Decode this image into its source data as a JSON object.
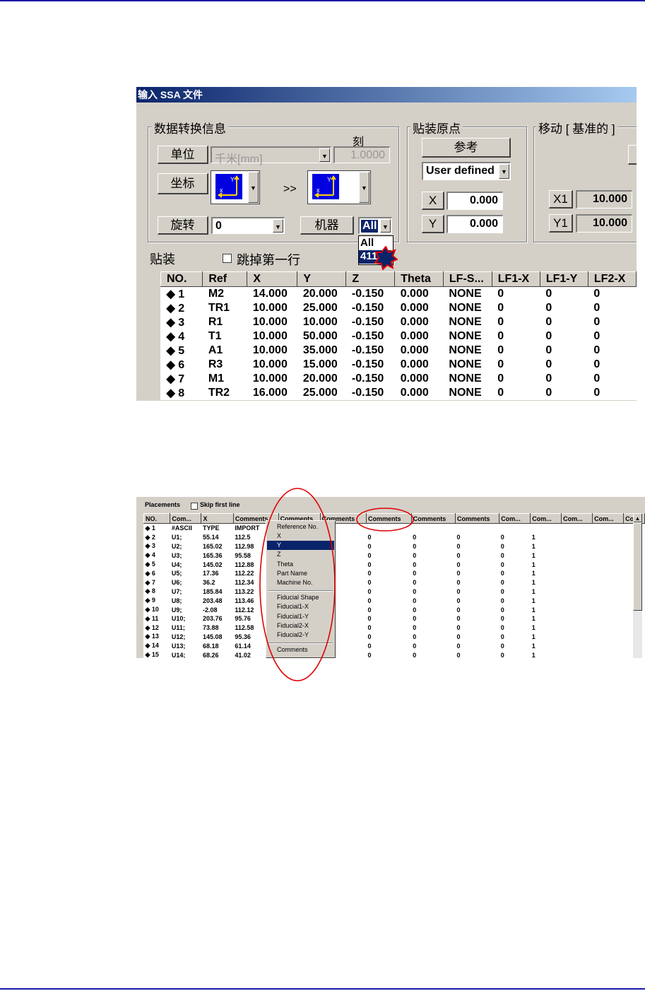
{
  "dialog": {
    "title": "输入 SSA 文件",
    "conversion_group": {
      "label": "数据转换信息",
      "scale_label": "刻",
      "unit_button": "单位",
      "unit_value": "千米[mm]",
      "scale_value": "1.0000",
      "coord_button": "坐标",
      "arrow_text": ">>",
      "rotate_button": "旋转",
      "rotate_value": "0",
      "machine_button": "机器",
      "machine_value": "All",
      "machine_options": [
        "All",
        "411"
      ]
    },
    "origin_group": {
      "label": "贴装原点",
      "reference_button": "参考",
      "reference_value": "User defined",
      "x_label": "X",
      "x_value": "0.000",
      "y_label": "Y",
      "y_value": "0.000"
    },
    "move_group": {
      "label": "移动 [ 基准的 ]",
      "x1_label": "X1",
      "x1_value": "10.000",
      "y1_label": "Y1",
      "y1_value": "10.000"
    },
    "placement_label": "贴装",
    "skip_first_line": "跳掉第一行",
    "table": {
      "headers": [
        "NO.",
        "Ref",
        "X",
        "Y",
        "Z",
        "Theta",
        "LF-S...",
        "LF1-X",
        "LF1-Y",
        "LF2-X"
      ],
      "rows": [
        [
          "◆ 1",
          "M2",
          "14.000",
          "20.000",
          "-0.150",
          "0.000",
          "NONE",
          "0",
          "0",
          "0"
        ],
        [
          "◆ 2",
          "TR1",
          "10.000",
          "25.000",
          "-0.150",
          "0.000",
          "NONE",
          "0",
          "0",
          "0"
        ],
        [
          "◆ 3",
          "R1",
          "10.000",
          "10.000",
          "-0.150",
          "0.000",
          "NONE",
          "0",
          "0",
          "0"
        ],
        [
          "◆ 4",
          "T1",
          "10.000",
          "50.000",
          "-0.150",
          "0.000",
          "NONE",
          "0",
          "0",
          "0"
        ],
        [
          "◆ 5",
          "A1",
          "10.000",
          "35.000",
          "-0.150",
          "0.000",
          "NONE",
          "0",
          "0",
          "0"
        ],
        [
          "◆ 6",
          "R3",
          "10.000",
          "15.000",
          "-0.150",
          "0.000",
          "NONE",
          "0",
          "0",
          "0"
        ],
        [
          "◆ 7",
          "M1",
          "10.000",
          "20.000",
          "-0.150",
          "0.000",
          "NONE",
          "0",
          "0",
          "0"
        ],
        [
          "◆ 8",
          "TR2",
          "16.000",
          "25.000",
          "-0.150",
          "0.000",
          "NONE",
          "0",
          "0",
          "0"
        ]
      ]
    }
  },
  "placements": {
    "label": "Placements",
    "skip_first_line": "Skip first line",
    "headers": [
      "NO.",
      "Com...",
      "X",
      "Comments",
      "Comments",
      "Comments",
      "Comments",
      "Comments",
      "Comments",
      "Com...",
      "Com...",
      "Com...",
      "Com...",
      "Com"
    ],
    "rows": [
      [
        "◆ 1",
        "#ASCII",
        "TYPE",
        "IMPORT",
        "",
        "",
        "",
        "",
        "",
        "",
        "",
        "",
        "",
        ""
      ],
      [
        "◆ 2",
        "U1;",
        "55.14",
        "112.5",
        "",
        "",
        "0",
        "0",
        "0",
        "0",
        "1",
        "",
        "",
        ""
      ],
      [
        "◆ 3",
        "U2;",
        "165.02",
        "112.98",
        "",
        "",
        "0",
        "0",
        "0",
        "0",
        "1",
        "",
        "",
        ""
      ],
      [
        "◆ 4",
        "U3;",
        "165.36",
        "95.58",
        "",
        "",
        "0",
        "0",
        "0",
        "0",
        "1",
        "",
        "",
        ""
      ],
      [
        "◆ 5",
        "U4;",
        "145.02",
        "112.88",
        "",
        "",
        "0",
        "0",
        "0",
        "0",
        "1",
        "",
        "",
        ""
      ],
      [
        "◆ 6",
        "U5;",
        "17.36",
        "112.22",
        "",
        "",
        "0",
        "0",
        "0",
        "0",
        "1",
        "",
        "",
        ""
      ],
      [
        "◆ 7",
        "U6;",
        "36.2",
        "112.34",
        "",
        "",
        "0",
        "0",
        "0",
        "0",
        "1",
        "",
        "",
        ""
      ],
      [
        "◆ 8",
        "U7;",
        "185.84",
        "113.22",
        "",
        "",
        "0",
        "0",
        "0",
        "0",
        "1",
        "",
        "",
        ""
      ],
      [
        "◆ 9",
        "U8;",
        "203.48",
        "113.46",
        "",
        "",
        "0",
        "0",
        "0",
        "0",
        "1",
        "",
        "",
        ""
      ],
      [
        "◆ 10",
        "U9;",
        "-2.08",
        "112.12",
        "",
        "",
        "0",
        "0",
        "0",
        "0",
        "1",
        "",
        "",
        ""
      ],
      [
        "◆ 11",
        "U10;",
        "203.76",
        "95.76",
        "",
        "",
        "0",
        "0",
        "0",
        "0",
        "1",
        "",
        "",
        ""
      ],
      [
        "◆ 12",
        "U11;",
        "73.88",
        "112.58",
        "",
        "",
        "0",
        "0",
        "0",
        "0",
        "1",
        "",
        "",
        ""
      ],
      [
        "◆ 13",
        "U12;",
        "145.08",
        "95.36",
        "",
        "",
        "0",
        "0",
        "0",
        "0",
        "1",
        "",
        "",
        ""
      ],
      [
        "◆ 14",
        "U13;",
        "68.18",
        "61.14",
        "",
        "",
        "0",
        "0",
        "0",
        "0",
        "1",
        "",
        "",
        ""
      ],
      [
        "◆ 15",
        "U14;",
        "68.26",
        "41.02",
        "",
        "",
        "0",
        "0",
        "0",
        "0",
        "1",
        "",
        "",
        ""
      ]
    ],
    "context_menu": {
      "items": [
        "Reference No.",
        "X",
        "Y",
        "Z",
        "Theta",
        "Part Name",
        "Machine No.",
        "Fiducial Shape",
        "Fiducial1-X",
        "Fiducial1-Y",
        "Fiducial2-X",
        "Fiducial2-Y",
        "Comments"
      ],
      "selected": "Y"
    }
  },
  "colors": {
    "rule": "#1a1aa6",
    "window_bg": "#d4d0c8",
    "selection": "#0a246a",
    "annotation": "#e00000"
  }
}
